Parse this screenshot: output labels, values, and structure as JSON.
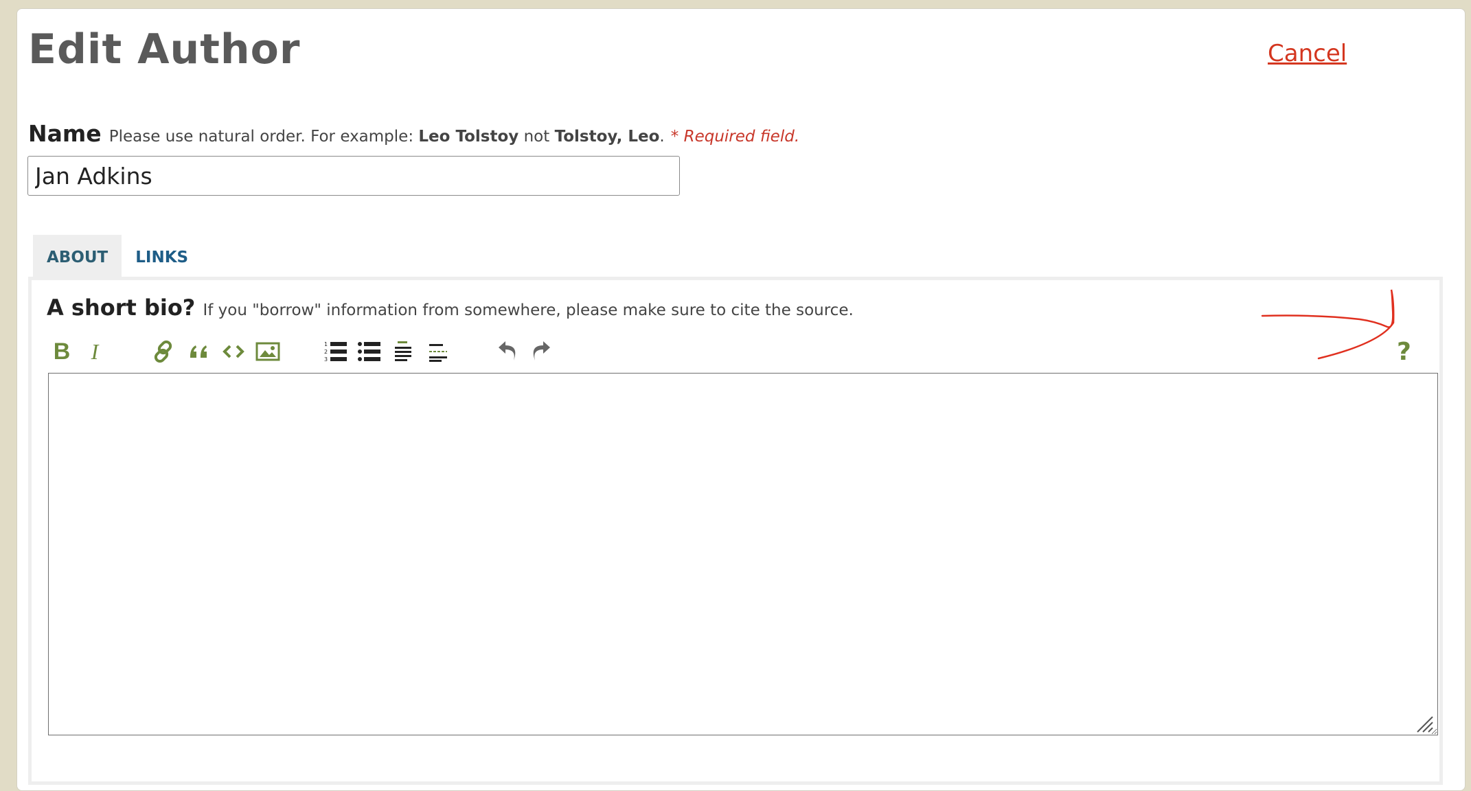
{
  "header": {
    "title": "Edit Author",
    "cancel_label": "Cancel"
  },
  "name_field": {
    "label": "Name",
    "hint_prefix": "Please use natural order. For example:",
    "hint_example_good": "Leo Tolstoy",
    "hint_middle": "not",
    "hint_example_bad": "Tolstoy, Leo",
    "hint_suffix": ".",
    "required_text": "* Required field.",
    "value": "Jan Adkins"
  },
  "tabs": [
    {
      "label": "ABOUT",
      "active": true
    },
    {
      "label": "LINKS",
      "active": false
    }
  ],
  "bio": {
    "label": "A short bio?",
    "hint": "If you \"borrow\" information from somewhere, please make sure to cite the source.",
    "value": ""
  },
  "toolbar": {
    "bold_label": "B",
    "italic_label": "I",
    "help_label": "?",
    "buttons": [
      {
        "name": "bold-icon"
      },
      {
        "name": "italic-icon"
      },
      {
        "name": "link-icon"
      },
      {
        "name": "quote-icon"
      },
      {
        "name": "code-icon"
      },
      {
        "name": "image-icon"
      },
      {
        "name": "numbered-list-icon"
      },
      {
        "name": "bulleted-list-icon"
      },
      {
        "name": "heading-icon"
      },
      {
        "name": "horizontal-rule-icon"
      },
      {
        "name": "undo-icon"
      },
      {
        "name": "redo-icon"
      },
      {
        "name": "help-icon"
      }
    ]
  },
  "colors": {
    "background": "#e1dcc6",
    "title": "#5a5a5a",
    "cancel": "#d4361f",
    "required": "#c8372a",
    "toolbar_green": "#6d8a3c",
    "tab_active": "#2c5e73",
    "tab_inactive": "#1e5d87",
    "annotation": "#e0301f"
  }
}
